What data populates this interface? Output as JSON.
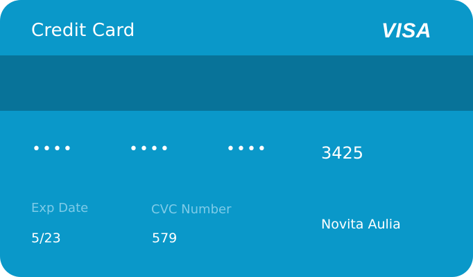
{
  "card": {
    "title": "Credit Card",
    "brand": "VISA",
    "number_masked_groups": [
      "••••",
      "••••",
      "••••"
    ],
    "number_last4": "3425",
    "exp_label": "Exp Date",
    "exp_value": "5/23",
    "cvc_label": "CVC Number",
    "cvc_value": "579",
    "holder_name": "Novita Aulia"
  },
  "colors": {
    "card_background": "#0a98c9",
    "stripe": "#087399",
    "label": "#7ecbe8",
    "text": "#ffffff"
  }
}
